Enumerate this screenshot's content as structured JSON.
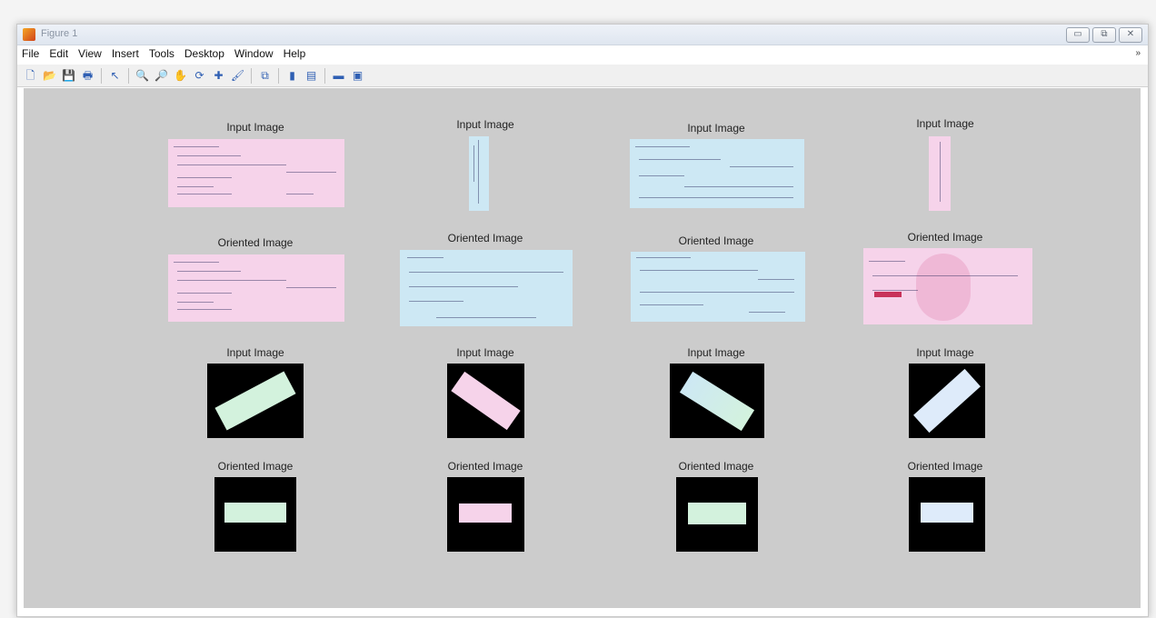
{
  "window": {
    "title": "Figure 1",
    "buttons": [
      "▭",
      "⧉",
      "✕"
    ]
  },
  "menu": [
    "File",
    "Edit",
    "View",
    "Insert",
    "Tools",
    "Desktop",
    "Window",
    "Help"
  ],
  "menu_overflow": "»",
  "toolbar": [
    {
      "name": "new-figure-icon",
      "glyph": "🗋"
    },
    {
      "name": "open-file-icon",
      "glyph": "📂"
    },
    {
      "name": "save-icon",
      "glyph": "💾"
    },
    {
      "name": "print-icon",
      "glyph": "🖶"
    },
    {
      "name": "sep"
    },
    {
      "name": "edit-plot-pointer-icon",
      "glyph": "↖"
    },
    {
      "name": "sep"
    },
    {
      "name": "zoom-in-icon",
      "glyph": "🔍"
    },
    {
      "name": "zoom-out-icon",
      "glyph": "🔎"
    },
    {
      "name": "pan-hand-icon",
      "glyph": "✋"
    },
    {
      "name": "rotate-3d-icon",
      "glyph": "⟳"
    },
    {
      "name": "data-cursor-icon",
      "glyph": "✚"
    },
    {
      "name": "brush-icon",
      "glyph": "🖌"
    },
    {
      "name": "sep"
    },
    {
      "name": "link-plot-icon",
      "glyph": "⧉"
    },
    {
      "name": "sep"
    },
    {
      "name": "colorbar-icon",
      "glyph": "▮"
    },
    {
      "name": "legend-icon",
      "glyph": "▤"
    },
    {
      "name": "sep"
    },
    {
      "name": "hide-plot-tools-icon",
      "glyph": "▬"
    },
    {
      "name": "show-plot-tools-icon",
      "glyph": "▣"
    }
  ],
  "panels": {
    "row1": [
      "Input Image",
      "Input Image",
      "Input Image",
      "Input Image"
    ],
    "row2": [
      "Oriented Image",
      "Oriented Image",
      "Oriented Image",
      "Oriented Image"
    ],
    "row3": [
      "Input Image",
      "Input Image",
      "Input Image",
      "Input Image"
    ],
    "row4": [
      "Oriented Image",
      "Oriented Image",
      "Oriented Image",
      "Oriented Image"
    ]
  },
  "colors": {
    "pink": "#f6d3ea",
    "blue": "#cde8f4",
    "green": "#d3f2dd",
    "light_blue": "#deebfa",
    "canvas": "#cccccc"
  }
}
